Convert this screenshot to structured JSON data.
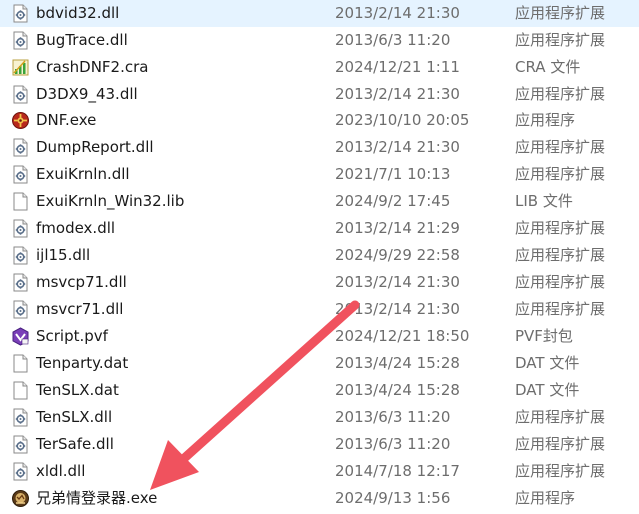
{
  "files": [
    {
      "name": "bdvid32.dll",
      "date": "2013/2/14 21:30",
      "type": "应用程序扩展",
      "icon": "dll-icon"
    },
    {
      "name": "BugTrace.dll",
      "date": "2013/6/3 11:20",
      "type": "应用程序扩展",
      "icon": "dll-icon"
    },
    {
      "name": "CrashDNF2.cra",
      "date": "2024/12/21 1:11",
      "type": "CRA 文件",
      "icon": "cra-file-icon"
    },
    {
      "name": "D3DX9_43.dll",
      "date": "2013/2/14 21:30",
      "type": "应用程序扩展",
      "icon": "dll-icon"
    },
    {
      "name": "DNF.exe",
      "date": "2023/10/10 20:05",
      "type": "应用程序",
      "icon": "dnf-app-icon"
    },
    {
      "name": "DumpReport.dll",
      "date": "2013/2/14 21:30",
      "type": "应用程序扩展",
      "icon": "dll-icon"
    },
    {
      "name": "ExuiKrnln.dll",
      "date": "2021/7/1 10:13",
      "type": "应用程序扩展",
      "icon": "dll-icon"
    },
    {
      "name": "ExuiKrnln_Win32.lib",
      "date": "2024/9/2 17:45",
      "type": "LIB 文件",
      "icon": "blank-file-icon"
    },
    {
      "name": "fmodex.dll",
      "date": "2013/2/14 21:29",
      "type": "应用程序扩展",
      "icon": "dll-icon"
    },
    {
      "name": "ijl15.dll",
      "date": "2024/9/29 22:58",
      "type": "应用程序扩展",
      "icon": "dll-icon"
    },
    {
      "name": "msvcp71.dll",
      "date": "2013/2/14 21:30",
      "type": "应用程序扩展",
      "icon": "dll-icon"
    },
    {
      "name": "msvcr71.dll",
      "date": "2013/2/14 21:30",
      "type": "应用程序扩展",
      "icon": "dll-icon"
    },
    {
      "name": "Script.pvf",
      "date": "2024/12/21 18:50",
      "type": "PVF封包",
      "icon": "pvf-icon"
    },
    {
      "name": "Tenparty.dat",
      "date": "2013/4/24 15:28",
      "type": "DAT 文件",
      "icon": "blank-file-icon"
    },
    {
      "name": "TenSLX.dat",
      "date": "2013/4/24 15:28",
      "type": "DAT 文件",
      "icon": "blank-file-icon"
    },
    {
      "name": "TenSLX.dll",
      "date": "2013/6/3 11:20",
      "type": "应用程序扩展",
      "icon": "dll-icon"
    },
    {
      "name": "TerSafe.dll",
      "date": "2013/6/3 11:20",
      "type": "应用程序扩展",
      "icon": "dll-icon"
    },
    {
      "name": "xldl.dll",
      "date": "2014/7/18 12:17",
      "type": "应用程序扩展",
      "icon": "dll-icon"
    },
    {
      "name": "兄弟情登录器.exe",
      "date": "2024/9/13 1:56",
      "type": "应用程序",
      "icon": "launcher-app-icon"
    }
  ],
  "annotation": {
    "arrow_color": "#f0525e",
    "points_to": "兄弟情登录器.exe"
  }
}
